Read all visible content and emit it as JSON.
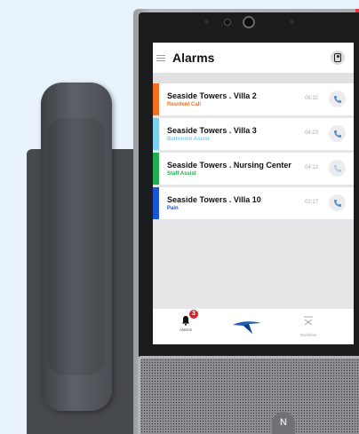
{
  "app": {
    "title": "Alarms"
  },
  "alarms": [
    {
      "title": "Seaside Towers . Villa 2",
      "type": "Resident Call",
      "time": "06:32",
      "color": "#f37021",
      "call_enabled": true
    },
    {
      "title": "Seaside Towers . Villa 3",
      "type": "Bathroom Assist",
      "time": "04:23",
      "color": "#7dd0ec",
      "call_enabled": true
    },
    {
      "title": "Seaside Towers . Nursing Center",
      "type": "Staff Assist",
      "time": "04:12",
      "color": "#1fad4f",
      "call_enabled": false
    },
    {
      "title": "Seaside Towers . Villa 10",
      "type": "Pain",
      "time": "02:17",
      "color": "#1a55d6",
      "call_enabled": true
    }
  ],
  "nav": {
    "alarms_label": "Alarms",
    "alarms_badge": "3",
    "workflow_label": "Workflow"
  },
  "device": {
    "nfc_mark": "N"
  },
  "colors": {
    "accent": "#5b8fc4",
    "badge": "#d8232a",
    "logo": "#1a5fb4"
  }
}
